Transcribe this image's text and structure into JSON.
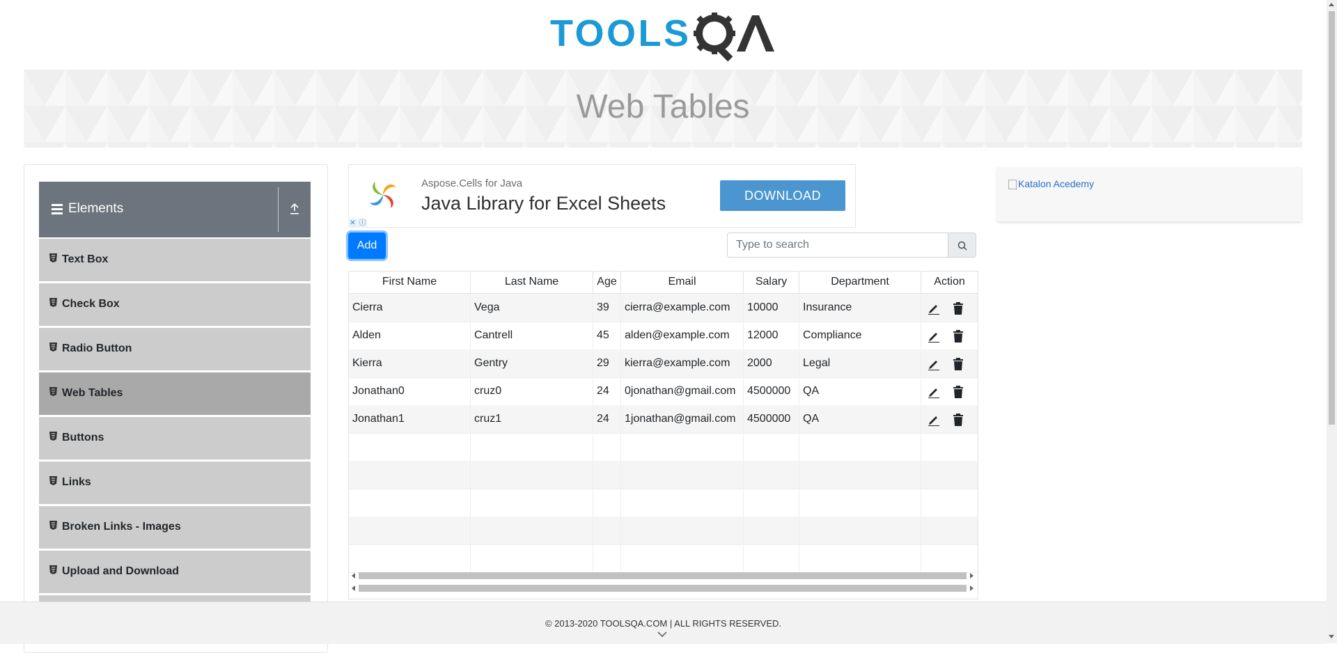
{
  "header": {
    "logo_text": "TOOLSQA",
    "page_title": "Web Tables"
  },
  "sidebar": {
    "group_title": "Elements",
    "group_icon": "hamburger-icon",
    "collapse_icon": "collapse-up-icon",
    "items": [
      {
        "label": "Text Box",
        "active": false
      },
      {
        "label": "Check Box",
        "active": false
      },
      {
        "label": "Radio Button",
        "active": false
      },
      {
        "label": "Web Tables",
        "active": true
      },
      {
        "label": "Buttons",
        "active": false
      },
      {
        "label": "Links",
        "active": false
      },
      {
        "label": "Broken Links - Images",
        "active": false
      },
      {
        "label": "Upload and Download",
        "active": false
      }
    ]
  },
  "ad": {
    "small_text": "Aspose.Cells for Java",
    "headline": "Java Library for Excel Sheets",
    "button_label": "DOWNLOAD",
    "badge_close": "✕",
    "badge_info": "ⓘ"
  },
  "right_ad": {
    "alt_text": "Katalon Acedemy"
  },
  "controls": {
    "add_label": "Add",
    "search_placeholder": "Type to search"
  },
  "table": {
    "headers": [
      "First Name",
      "Last Name",
      "Age",
      "Email",
      "Salary",
      "Department",
      "Action"
    ],
    "rows": [
      [
        "Cierra",
        "Vega",
        "39",
        "cierra@example.com",
        "10000",
        "Insurance"
      ],
      [
        "Alden",
        "Cantrell",
        "45",
        "alden@example.com",
        "12000",
        "Compliance"
      ],
      [
        "Kierra",
        "Gentry",
        "29",
        "kierra@example.com",
        "2000",
        "Legal"
      ],
      [
        "Jonathan0",
        "cruz0",
        "24",
        "0jonathan@gmail.com",
        "4500000",
        "QA"
      ],
      [
        "Jonathan1",
        "cruz1",
        "24",
        "1jonathan@gmail.com",
        "4500000",
        "QA"
      ]
    ],
    "empty_rows": 5,
    "action_icons": [
      "edit-pencil-icon",
      "delete-trash-icon"
    ]
  },
  "footer": {
    "copyright": "© 2013-2020 TOOLSQA.COM | ALL RIGHTS RESERVED."
  },
  "colors": {
    "primary": "#007bff",
    "logo_blue": "#1b9ad6",
    "sidebar_header": "#6c757d",
    "menu_bg": "#cccccc",
    "menu_active": "#a9a9a9",
    "ad_button": "#4b95d1"
  }
}
